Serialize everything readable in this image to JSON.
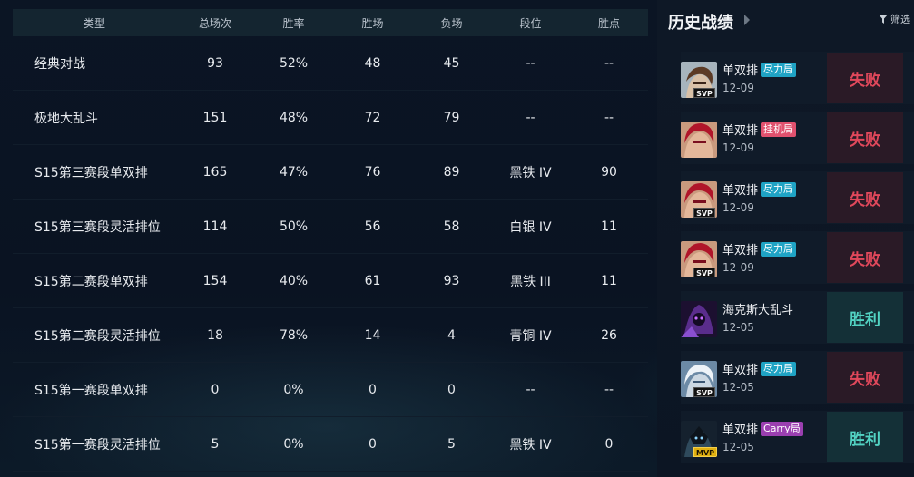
{
  "stats": {
    "headers": [
      "类型",
      "总场次",
      "胜率",
      "胜场",
      "负场",
      "段位",
      "胜点"
    ],
    "rows": [
      [
        "经典对战",
        "93",
        "52%",
        "48",
        "45",
        "--",
        "--"
      ],
      [
        "极地大乱斗",
        "151",
        "48%",
        "72",
        "79",
        "--",
        "--"
      ],
      [
        "S15第三赛段单双排",
        "165",
        "47%",
        "76",
        "89",
        "黑铁 IV",
        "90"
      ],
      [
        "S15第三赛段灵活排位",
        "114",
        "50%",
        "56",
        "58",
        "白银 IV",
        "11"
      ],
      [
        "S15第二赛段单双排",
        "154",
        "40%",
        "61",
        "93",
        "黑铁 III",
        "11"
      ],
      [
        "S15第二赛段灵活排位",
        "18",
        "78%",
        "14",
        "4",
        "青铜 IV",
        "26"
      ],
      [
        "S15第一赛段单双排",
        "0",
        "0%",
        "0",
        "0",
        "--",
        "--"
      ],
      [
        "S15第一赛段灵活排位",
        "5",
        "0%",
        "0",
        "5",
        "黑铁 IV",
        "0"
      ]
    ]
  },
  "history": {
    "title": "历史战绩",
    "filter_label": "筛选",
    "matches": [
      {
        "mode": "单双排",
        "tag": "尽力局",
        "tag_color": "#1fa3c4",
        "date": "12-09",
        "result": "失败",
        "outcome": "lose",
        "badge": "SVP",
        "avatar_icon": "champion-brown-hair-icon"
      },
      {
        "mode": "单双排",
        "tag": "挂机局",
        "tag_color": "#e0516e",
        "date": "12-09",
        "result": "失败",
        "outcome": "lose",
        "badge": "",
        "avatar_icon": "champion-red-hair-icon"
      },
      {
        "mode": "单双排",
        "tag": "尽力局",
        "tag_color": "#1fa3c4",
        "date": "12-09",
        "result": "失败",
        "outcome": "lose",
        "badge": "SVP",
        "avatar_icon": "champion-red-hair-icon"
      },
      {
        "mode": "单双排",
        "tag": "尽力局",
        "tag_color": "#1fa3c4",
        "date": "12-09",
        "result": "失败",
        "outcome": "lose",
        "badge": "SVP",
        "avatar_icon": "champion-red-hair-icon"
      },
      {
        "mode": "海克斯大乱斗",
        "tag": "",
        "tag_color": "",
        "date": "12-05",
        "result": "胜利",
        "outcome": "win",
        "badge": "",
        "avatar_icon": "champion-purple-void-icon"
      },
      {
        "mode": "单双排",
        "tag": "尽力局",
        "tag_color": "#1fa3c4",
        "date": "12-05",
        "result": "失败",
        "outcome": "lose",
        "badge": "SVP",
        "avatar_icon": "champion-white-hair-icon"
      },
      {
        "mode": "单双排",
        "tag": "Carry局",
        "tag_color": "#9b3fb0",
        "date": "12-05",
        "result": "胜利",
        "outcome": "win",
        "badge": "MVP",
        "avatar_icon": "champion-dark-armor-icon"
      }
    ]
  }
}
